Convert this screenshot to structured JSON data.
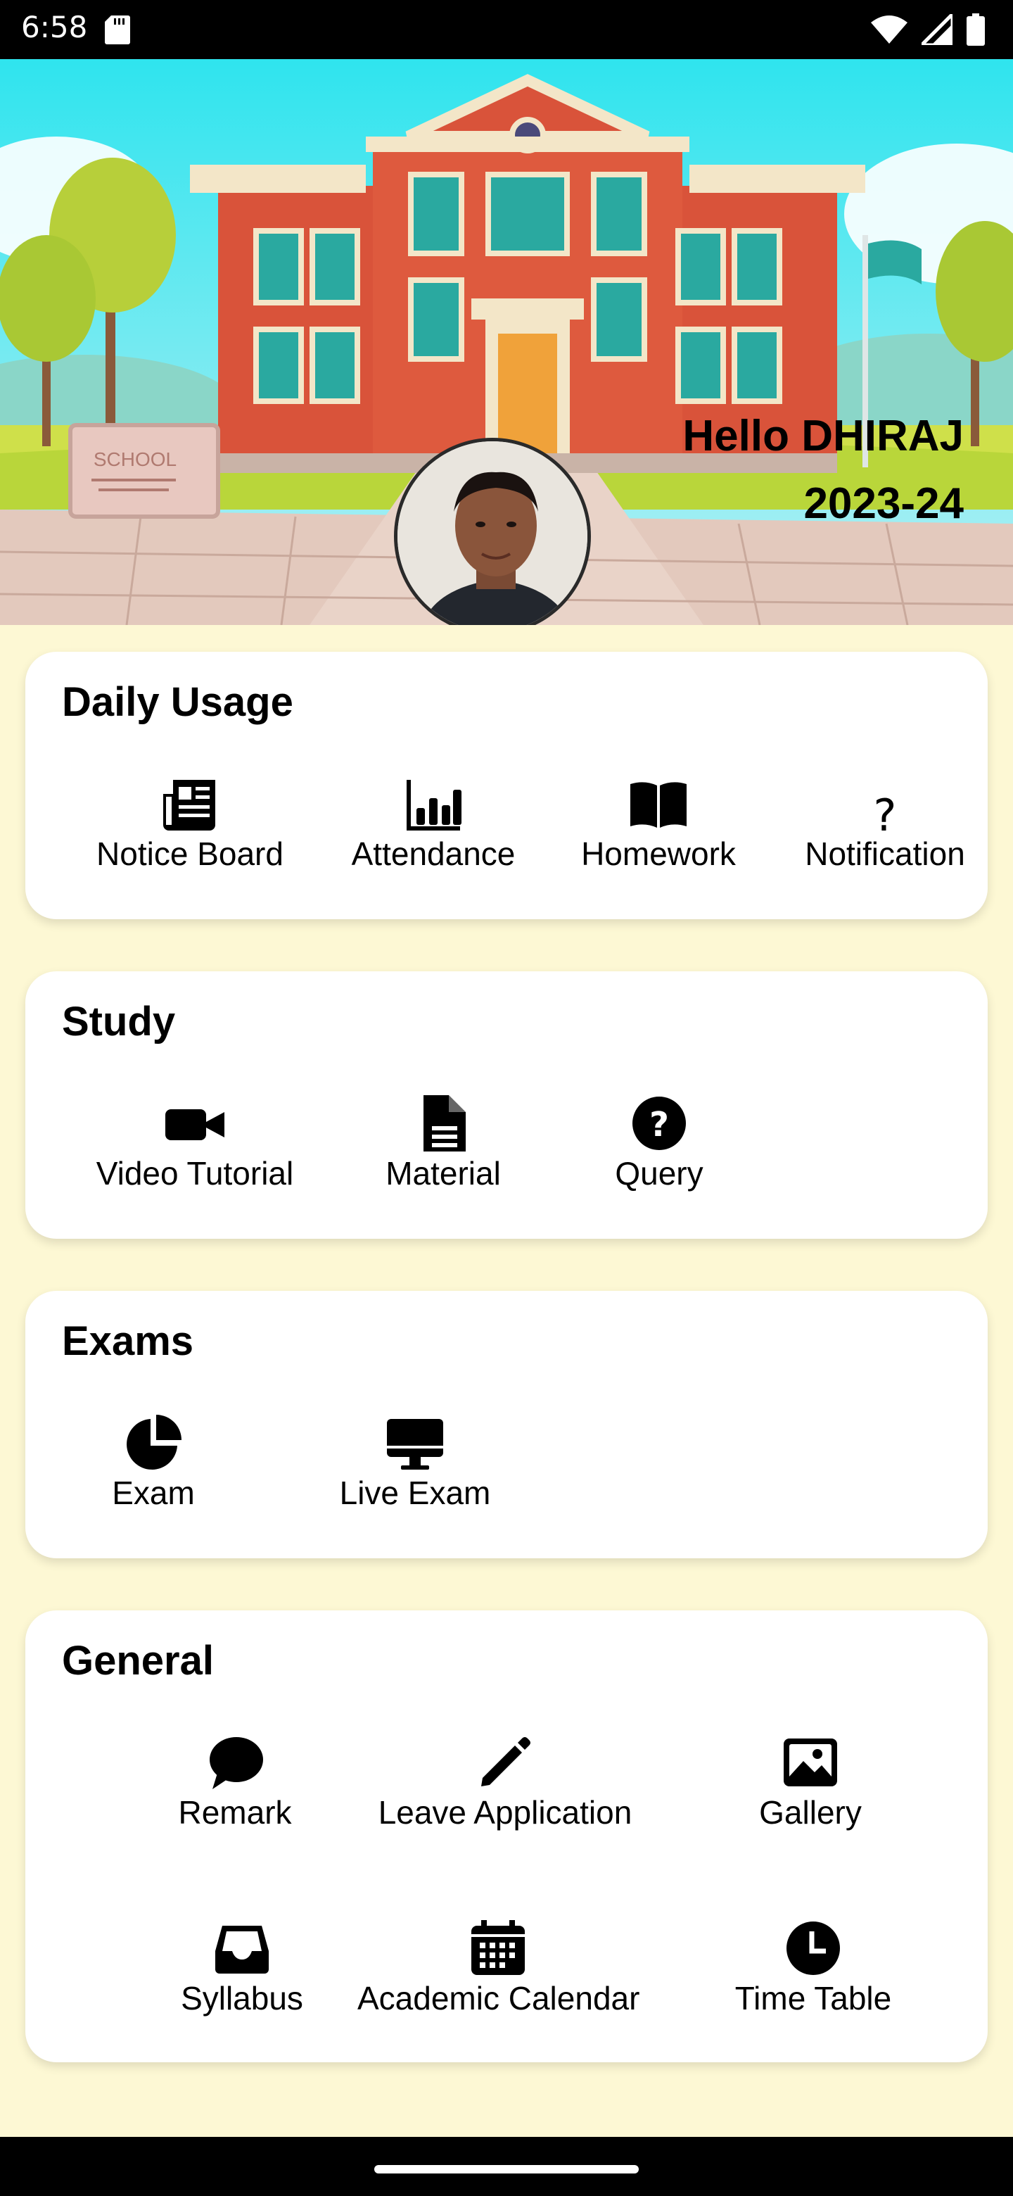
{
  "status": {
    "time": "6:58"
  },
  "header": {
    "greeting": "Hello DHIRAJ",
    "session": "2023-24",
    "sign_text": "SCHOOL"
  },
  "sections": {
    "daily": {
      "title": "Daily Usage",
      "items": [
        {
          "label": "Notice Board",
          "icon": "newspaper-icon"
        },
        {
          "label": "Attendance",
          "icon": "bar-chart-icon"
        },
        {
          "label": "Homework",
          "icon": "book-icon"
        },
        {
          "label": "Notification",
          "icon": "question-mark-icon"
        }
      ]
    },
    "study": {
      "title": "Study",
      "items": [
        {
          "label": "Video Tutorial",
          "icon": "video-camera-icon"
        },
        {
          "label": "Material",
          "icon": "document-icon"
        },
        {
          "label": "Query",
          "icon": "help-circle-icon"
        }
      ]
    },
    "exams": {
      "title": "Exams",
      "items": [
        {
          "label": "Exam",
          "icon": "pie-chart-icon"
        },
        {
          "label": "Live Exam",
          "icon": "desktop-icon"
        }
      ]
    },
    "general": {
      "title": "General",
      "items": [
        {
          "label": "Remark",
          "icon": "chat-bubble-icon"
        },
        {
          "label": "Leave Application",
          "icon": "pencil-icon"
        },
        {
          "label": "Gallery",
          "icon": "image-icon"
        },
        {
          "label": "Syllabus",
          "icon": "inbox-icon"
        },
        {
          "label": "Academic Calendar",
          "icon": "calendar-icon"
        },
        {
          "label": "Time Table",
          "icon": "clock-icon"
        }
      ]
    }
  },
  "colors": {
    "page_background": "#fdf8d4",
    "card_background": "#ffffff",
    "sky": "#3fd6e0",
    "building": "#d9533a"
  }
}
